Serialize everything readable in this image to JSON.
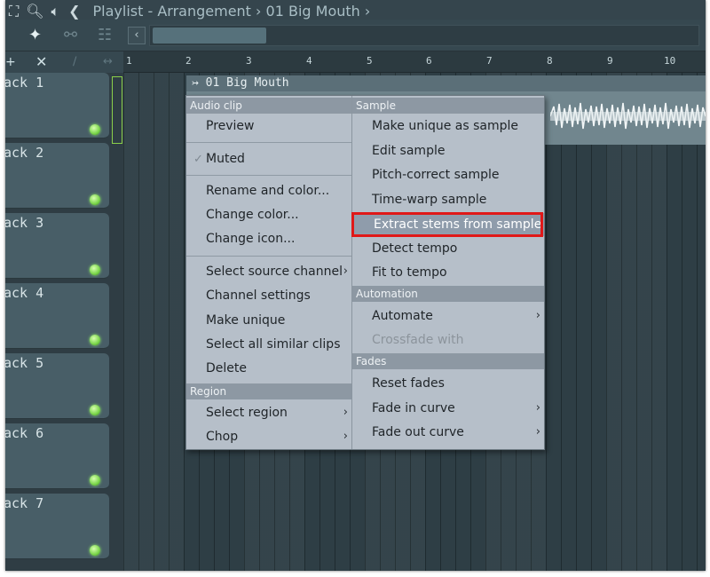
{
  "window": {
    "title": "Playlist - Arrangement › 01 Big Mouth ›"
  },
  "ruler": {
    "bars": [
      "1",
      "2",
      "3",
      "4",
      "5",
      "6",
      "7",
      "8",
      "9",
      "10"
    ]
  },
  "tracks": [
    {
      "name": "ack 1"
    },
    {
      "name": "ack 2"
    },
    {
      "name": "ack 3"
    },
    {
      "name": "ack 4"
    },
    {
      "name": "ack 5"
    },
    {
      "name": "ack 6"
    },
    {
      "name": "ack 7"
    }
  ],
  "clip": {
    "label": "01 Big Mouth",
    "arrow_icon": "↣"
  },
  "menu": {
    "left": {
      "audio_clip_header": "Audio clip",
      "preview": "Preview",
      "muted": "Muted",
      "check_icon": "✓",
      "rename_and_color": "Rename and color...",
      "change_color": "Change color...",
      "change_icon": "Change icon...",
      "select_source_channel": "Select source channel",
      "channel_settings": "Channel settings",
      "make_unique": "Make unique",
      "select_all_similar_clips": "Select all similar clips",
      "delete": "Delete",
      "region_header": "Region",
      "select_region": "Select region",
      "chop": "Chop"
    },
    "right": {
      "sample_header": "Sample",
      "make_unique_as_sample": "Make unique as sample",
      "edit_sample": "Edit sample",
      "pitch_correct_sample": "Pitch-correct sample",
      "time_warp_sample": "Time-warp sample",
      "extract_stems_from_sample": "Extract stems from sample",
      "detect_tempo": "Detect tempo",
      "fit_to_tempo": "Fit to tempo",
      "automation_header": "Automation",
      "automate": "Automate",
      "crossfade_with": "Crossfade with",
      "fades_header": "Fades",
      "reset_fades": "Reset fades",
      "fade_in_curve": "Fade in curve",
      "fade_out_curve": "Fade out curve"
    },
    "submenu_arrow": "›"
  },
  "colors": {
    "highlight_outline": "#e01818",
    "led_green": "#7ad64a",
    "menu_bg": "#b6bfc9",
    "section_header": "#8d98a3"
  }
}
